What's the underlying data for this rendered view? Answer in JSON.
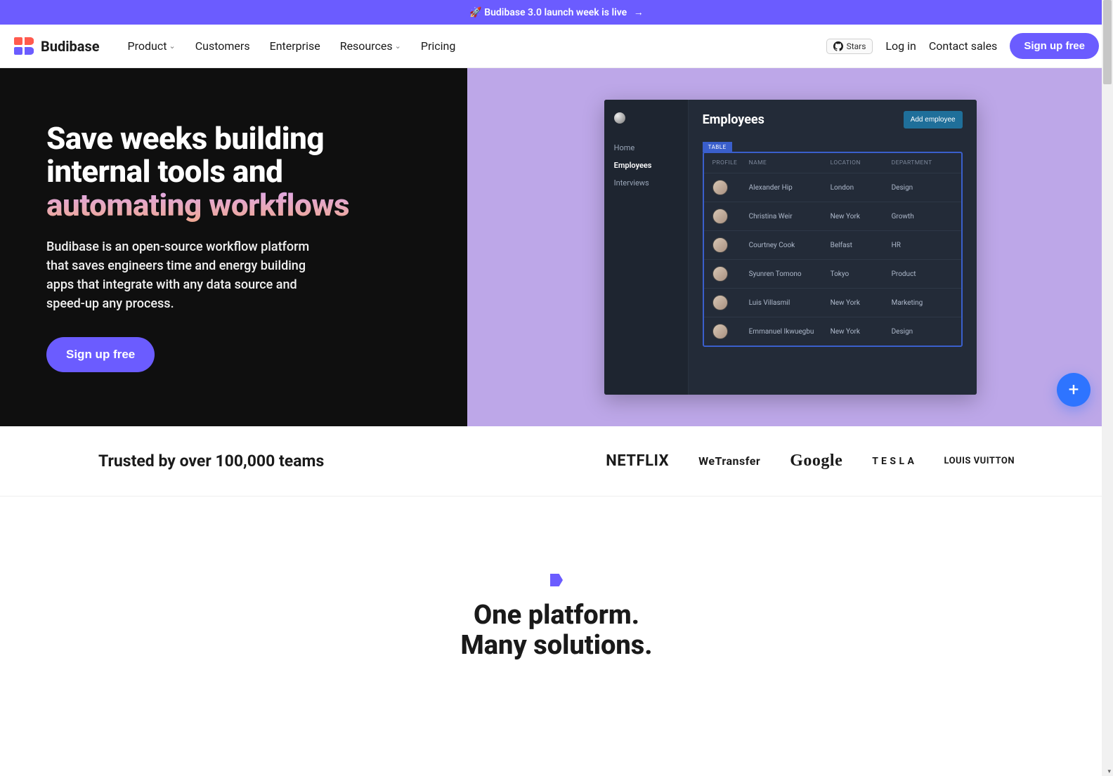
{
  "announce": {
    "emoji": "🚀",
    "text": "Budibase 3.0 launch week is live",
    "arrow": "→"
  },
  "brand": {
    "name": "Budibase"
  },
  "nav": {
    "product": "Product",
    "customers": "Customers",
    "enterprise": "Enterprise",
    "resources": "Resources",
    "pricing": "Pricing"
  },
  "header_right": {
    "stars_label": "Stars",
    "login": "Log in",
    "contact": "Contact sales",
    "signup": "Sign up free"
  },
  "hero": {
    "title_line1": "Save weeks building internal tools and ",
    "title_grad": "automating workflows",
    "subtitle": "Budibase is an open-source workflow platform that saves engineers time and energy building apps that integrate with any data source and speed-up any process.",
    "cta": "Sign up free"
  },
  "demo": {
    "sidebar": [
      "Home",
      "Employees",
      "Interviews"
    ],
    "active_index": 1,
    "title": "Employees",
    "add_btn": "Add employee",
    "tab": "TABLE",
    "columns": [
      "PROFILE",
      "NAME",
      "LOCATION",
      "DEPARTMENT"
    ],
    "rows": [
      {
        "name": "Alexander Hip",
        "location": "London",
        "department": "Design"
      },
      {
        "name": "Christina Weir",
        "location": "New York",
        "department": "Growth"
      },
      {
        "name": "Courtney Cook",
        "location": "Belfast",
        "department": "HR"
      },
      {
        "name": "Syunren Tomono",
        "location": "Tokyo",
        "department": "Product"
      },
      {
        "name": "Luis Villasmil",
        "location": "New York",
        "department": "Marketing"
      },
      {
        "name": "Emmanuel Ikwuegbu",
        "location": "New York",
        "department": "Design"
      }
    ],
    "fab": "+"
  },
  "trusted": {
    "text": "Trusted by over 100,000 teams",
    "logos": {
      "netflix": "NETFLIX",
      "wetransfer": "WeTransfer",
      "google": "Google",
      "tesla": "T E S L A",
      "lv": "LOUIS VUITTON"
    }
  },
  "section2": {
    "line1": "One platform.",
    "line2": "Many solutions."
  }
}
